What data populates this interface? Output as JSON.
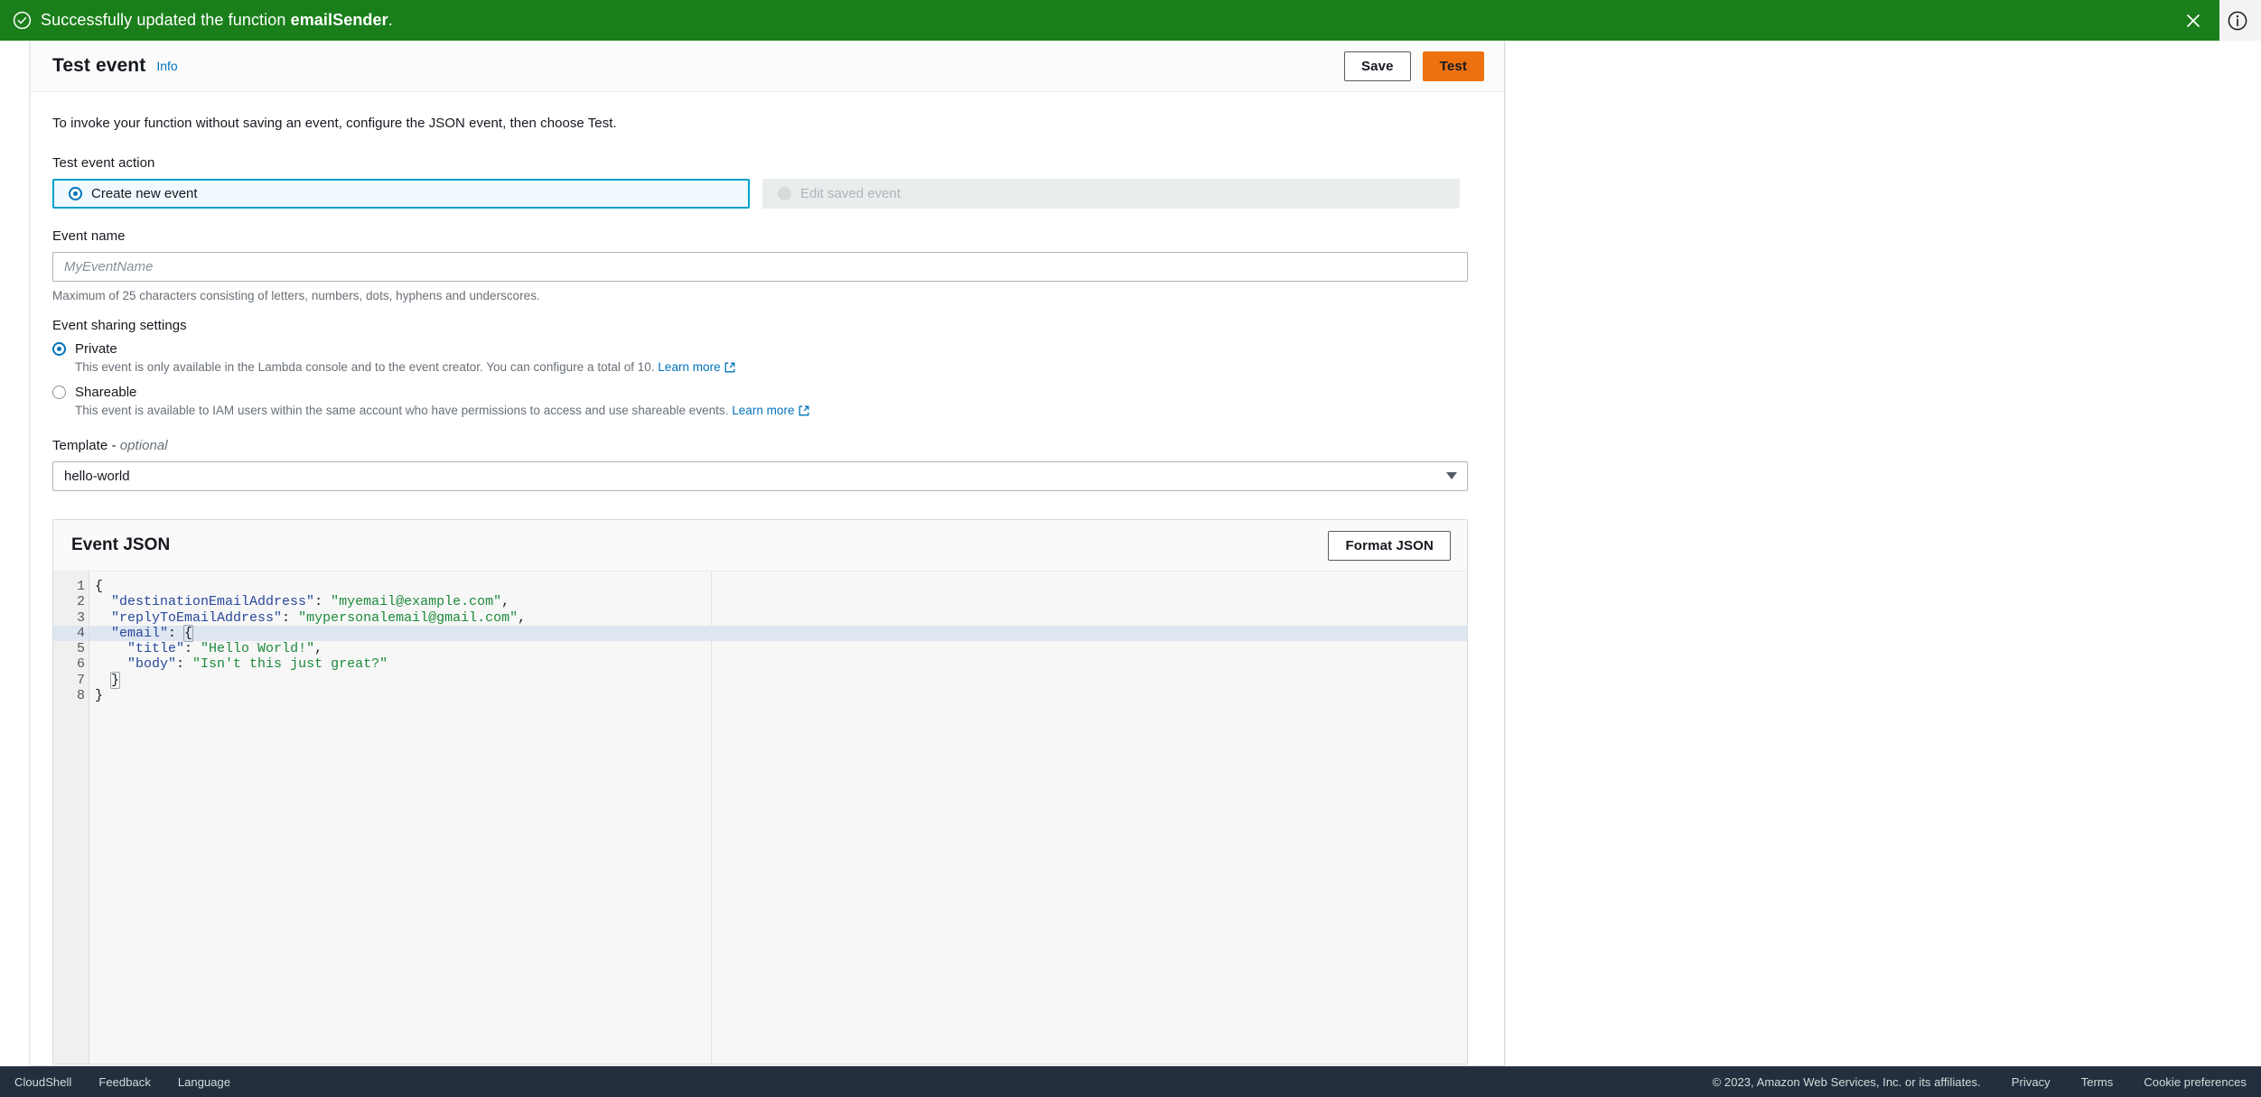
{
  "flash": {
    "icon": "check-circle-icon",
    "message_prefix": "Successfully updated the function ",
    "function_name": "emailSender",
    "message_suffix": ".",
    "close_icon": "close-icon",
    "background_color": "#1a7f1a"
  },
  "help_icon": "info-circle-icon",
  "header": {
    "title": "Test event",
    "info_label": "Info",
    "save_label": "Save",
    "test_label": "Test",
    "primary_color": "#ec7211"
  },
  "intro_text": "To invoke your function without saving an event, configure the JSON event, then choose Test.",
  "test_event_action": {
    "label": "Test event action",
    "options": [
      {
        "label": "Create new event",
        "selected": true,
        "disabled": false
      },
      {
        "label": "Edit saved event",
        "selected": false,
        "disabled": true
      }
    ],
    "selected_border_color": "#00a1c9"
  },
  "event_name": {
    "label": "Event name",
    "value": "",
    "placeholder": "MyEventName",
    "hint": "Maximum of 25 characters consisting of letters, numbers, dots, hyphens and underscores."
  },
  "event_sharing": {
    "label": "Event sharing settings",
    "options": [
      {
        "label": "Private",
        "selected": true,
        "description": "This event is only available in the Lambda console and to the event creator. You can configure a total of 10.",
        "learn_more": "Learn more"
      },
      {
        "label": "Shareable",
        "selected": false,
        "description": "This event is available to IAM users within the same account who have permissions to access and use shareable events.",
        "learn_more": "Learn more"
      }
    ]
  },
  "template": {
    "label_main": "Template - ",
    "label_optional": "optional",
    "selected_value": "hello-world",
    "caret_icon": "chevron-down-icon"
  },
  "event_json": {
    "title": "Event JSON",
    "format_button": "Format JSON",
    "active_line": 4,
    "lines": [
      {
        "n": 1,
        "foldable": true,
        "indent": 0,
        "tokens": [
          {
            "t": "punc",
            "v": "{"
          }
        ]
      },
      {
        "n": 2,
        "foldable": false,
        "indent": 2,
        "tokens": [
          {
            "t": "key",
            "v": "\"destinationEmailAddress\""
          },
          {
            "t": "punc",
            "v": ": "
          },
          {
            "t": "str",
            "v": "\"myemail@example.com\""
          },
          {
            "t": "punc",
            "v": ","
          }
        ]
      },
      {
        "n": 3,
        "foldable": false,
        "indent": 2,
        "tokens": [
          {
            "t": "key",
            "v": "\"replyToEmailAddress\""
          },
          {
            "t": "punc",
            "v": ": "
          },
          {
            "t": "str",
            "v": "\"mypersonalemail@gmail.com\""
          },
          {
            "t": "punc",
            "v": ","
          }
        ]
      },
      {
        "n": 4,
        "foldable": true,
        "indent": 2,
        "tokens": [
          {
            "t": "key",
            "v": "\"email\""
          },
          {
            "t": "punc",
            "v": ": "
          },
          {
            "t": "brace",
            "v": "{"
          },
          {
            "t": "caret",
            "v": ""
          }
        ]
      },
      {
        "n": 5,
        "foldable": false,
        "indent": 4,
        "tokens": [
          {
            "t": "key",
            "v": "\"title\""
          },
          {
            "t": "punc",
            "v": ": "
          },
          {
            "t": "str",
            "v": "\"Hello World!\""
          },
          {
            "t": "punc",
            "v": ","
          }
        ]
      },
      {
        "n": 6,
        "foldable": false,
        "indent": 4,
        "tokens": [
          {
            "t": "key",
            "v": "\"body\""
          },
          {
            "t": "punc",
            "v": ": "
          },
          {
            "t": "str",
            "v": "\"Isn't this just great?\""
          }
        ]
      },
      {
        "n": 7,
        "foldable": false,
        "indent": 2,
        "tokens": [
          {
            "t": "brace",
            "v": "}"
          }
        ]
      },
      {
        "n": 8,
        "foldable": false,
        "indent": 0,
        "tokens": [
          {
            "t": "punc",
            "v": "}"
          }
        ]
      }
    ],
    "raw": "{\n  \"destinationEmailAddress\": \"myemail@example.com\",\n  \"replyToEmailAddress\": \"mypersonalemail@gmail.com\",\n  \"email\": {\n    \"title\": \"Hello World!\",\n    \"body\": \"Isn't this just great?\"\n  }\n}",
    "key_color": "#28489c",
    "string_color": "#1c8a3a",
    "active_line_color": "#dee6f1"
  },
  "footer": {
    "left_links": [
      "CloudShell",
      "Feedback",
      "Language"
    ],
    "copyright": "© 2023, Amazon Web Services, Inc. or its affiliates.",
    "right_links": [
      "Privacy",
      "Terms",
      "Cookie preferences"
    ],
    "background_color": "#232f3e"
  }
}
